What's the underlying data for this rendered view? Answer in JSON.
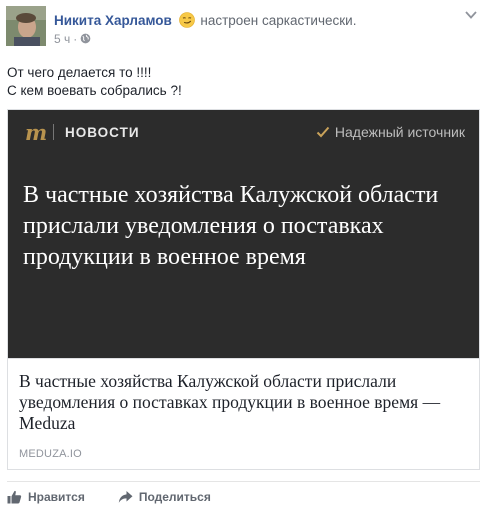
{
  "author": {
    "name": "Никита Харламов",
    "feeling": "настроен саркастически.",
    "feeling_emoji": "smirk-emoji-icon",
    "time": "5 ч",
    "separator": "·",
    "privacy_icon": "globe-icon"
  },
  "post": {
    "lines": [
      "От чего делается то !!!!",
      "С кем воевать собрались ?!"
    ]
  },
  "link_card": {
    "brand_logo": "m",
    "section": "НОВОСТИ",
    "trusted_label": "Надежный источник",
    "image_headline": "В частные хозяйства Калужской области прислали уведомления о поставках продукции в военное время",
    "title": "В частные хозяйства Калужской области прислали уведомления о поставках продукции в военное время — Meduza",
    "domain": "MEDUZA.IO",
    "colors": {
      "image_bg": "#2c2c2c",
      "logo": "#b8934e"
    }
  },
  "actions": {
    "like": "Нравится",
    "share": "Поделиться"
  },
  "colors": {
    "link_blue": "#365899",
    "muted": "#90949c"
  }
}
